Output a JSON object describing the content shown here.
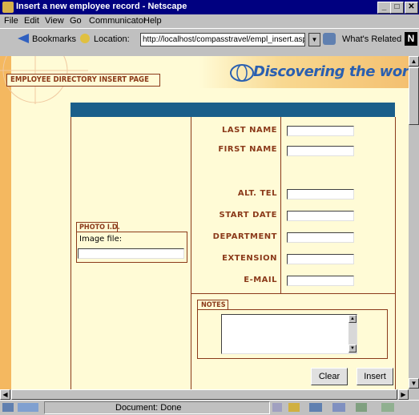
{
  "window": {
    "title": "Insert a new employee record - Netscape"
  },
  "menu": [
    "File",
    "Edit",
    "View",
    "Go",
    "Communicator",
    "Help"
  ],
  "toolbar": {
    "bookmarks": "Bookmarks",
    "location_label": "Location:",
    "url": "http://localhost/compasstravel/empl_insert.asp",
    "whats_related": "What's Related"
  },
  "page": {
    "header_title": "EMPLOYEE DIRECTORY INSERT PAGE",
    "banner": "Discovering the world",
    "photo": {
      "label": "PHOTO I.D.",
      "image_file_label": "Image file:",
      "image_file_value": ""
    },
    "fields": [
      {
        "label": "LAST NAME",
        "value": ""
      },
      {
        "label": "FIRST NAME",
        "value": ""
      },
      {
        "label": "ALT. TEL",
        "value": ""
      },
      {
        "label": "START DATE",
        "value": ""
      },
      {
        "label": "DEPARTMENT",
        "value": ""
      },
      {
        "label": "EXTENSION",
        "value": ""
      },
      {
        "label": "E-MAIL",
        "value": ""
      }
    ],
    "notes": {
      "label": "NOTES",
      "value": ""
    },
    "buttons": {
      "clear": "Clear",
      "insert": "Insert"
    }
  },
  "status": {
    "text": "Document: Done"
  },
  "colors": {
    "accent": "#8b3a1a",
    "header_band": "#1a5e8a",
    "page_bg": "#fffbd6",
    "sidebar_orange": "#f4b860",
    "banner_blue": "#2a5fb0"
  }
}
